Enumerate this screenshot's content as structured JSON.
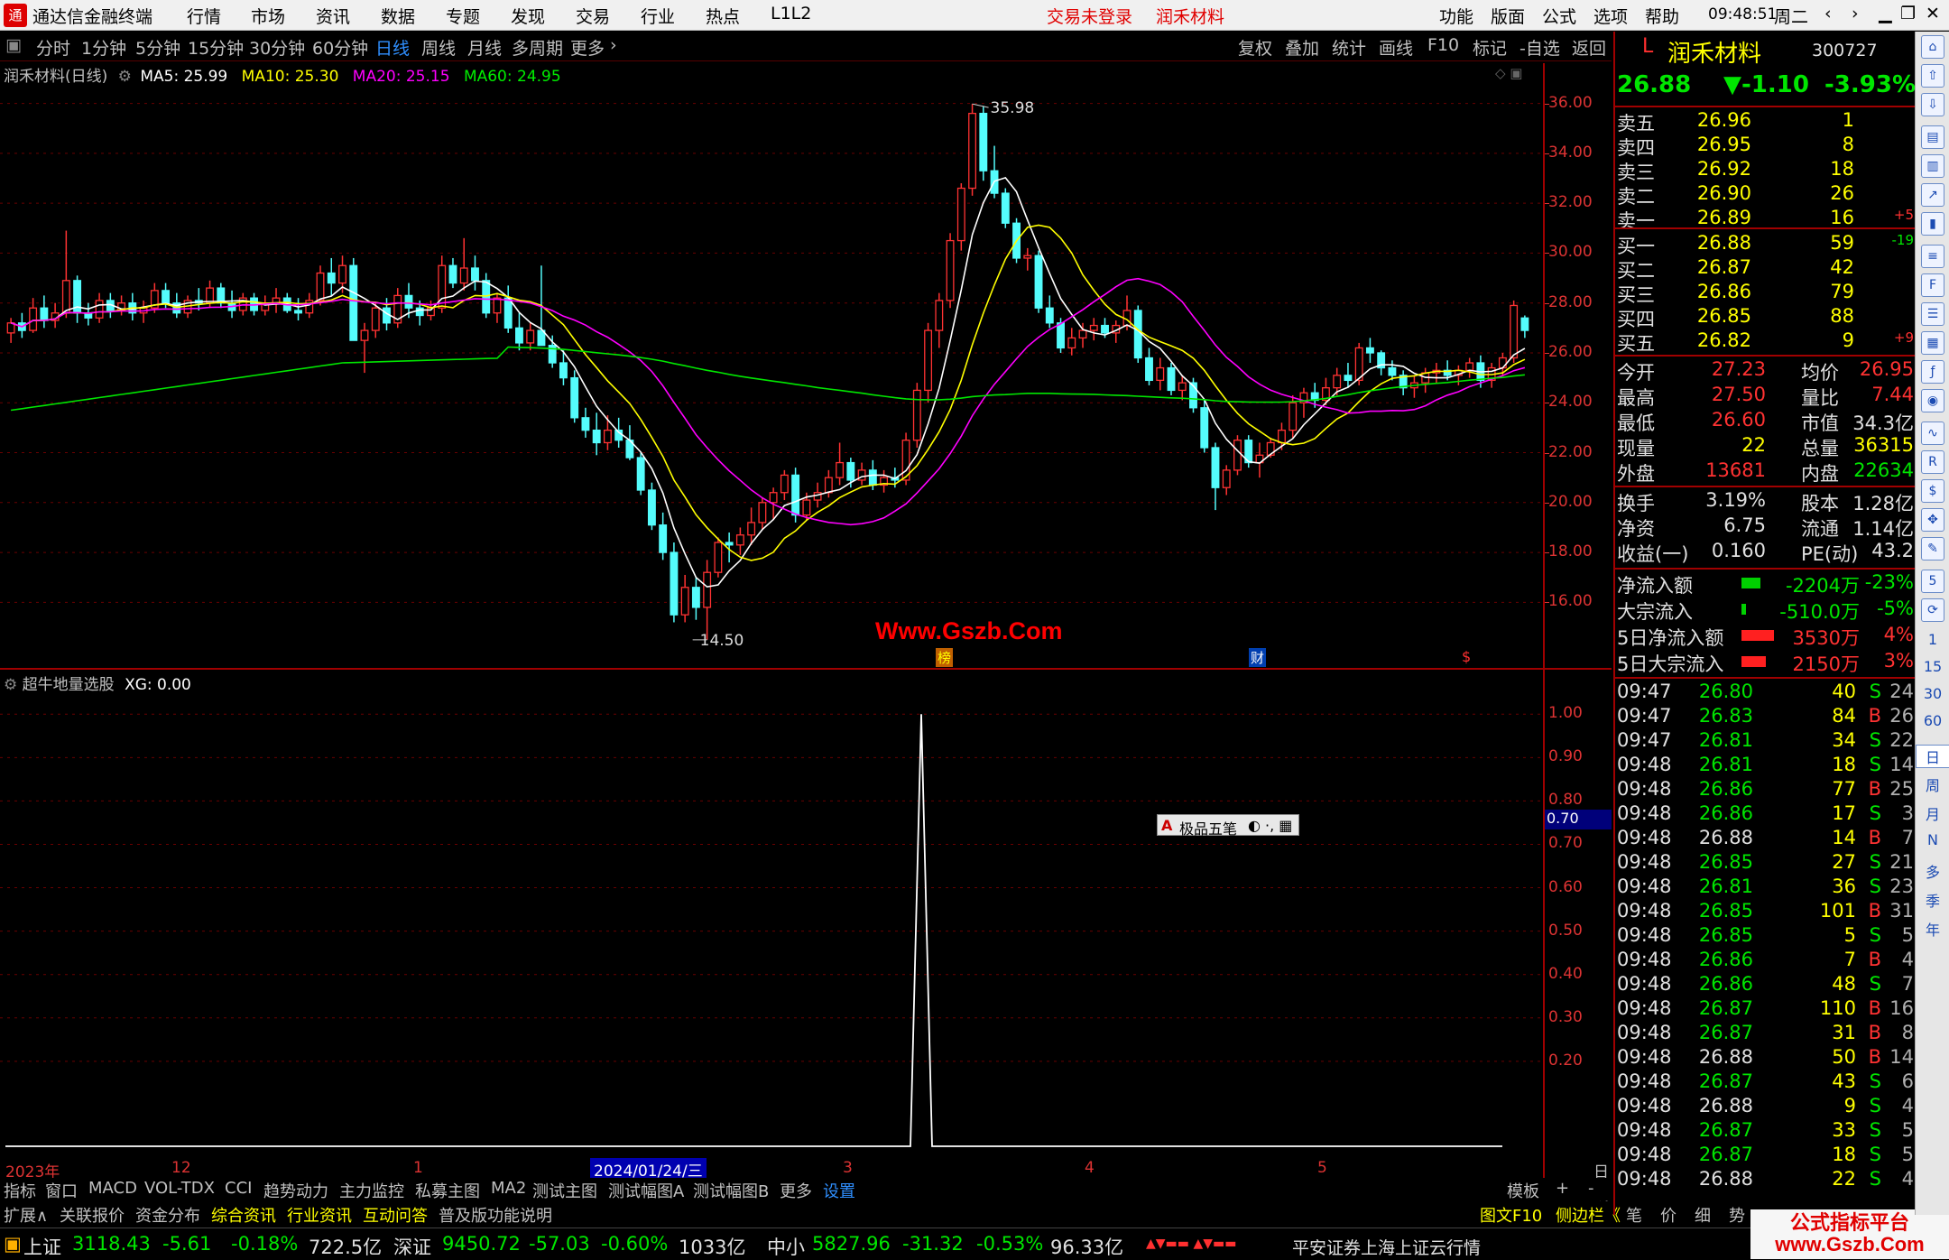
{
  "titlebar": {
    "app_title": "通达信金融终端",
    "menus": [
      "行情",
      "市场",
      "资讯",
      "数据",
      "专题",
      "发现",
      "交易",
      "行业",
      "热点",
      "L1L2"
    ],
    "login_status": "交易未登录",
    "stock_name": "润禾材料",
    "right_menus": [
      "功能",
      "版面",
      "公式",
      "选项",
      "帮助"
    ],
    "time": "09:48:51",
    "weekday": "周二"
  },
  "periods": {
    "items": [
      "分时",
      "1分钟",
      "5分钟",
      "15分钟",
      "30分钟",
      "60分钟",
      "日线",
      "周线",
      "月线",
      "多周期",
      "更多"
    ],
    "selected": "日线",
    "tools": [
      "复权",
      "叠加",
      "统计",
      "画线",
      "F10",
      "标记",
      "-自选",
      "返回"
    ]
  },
  "main_chart": {
    "title": "润禾材料(日线)",
    "ma_labels": [
      "MA5: 25.99",
      "MA10: 25.30",
      "MA20: 25.15",
      "MA60: 24.95"
    ],
    "high_label": "35.98",
    "low_label": "14.50",
    "y_ticks": [
      "36.00",
      "34.00",
      "32.00",
      "30.00",
      "28.00",
      "26.00",
      "24.00",
      "22.00",
      "20.00",
      "18.00",
      "16.00"
    ],
    "event_markers": [
      "榜",
      "财",
      "$"
    ]
  },
  "chart_data": {
    "type": "candlestick",
    "y_range": [
      15,
      36.6
    ],
    "high": 35.98,
    "low": 14.5,
    "ma_legend": {
      "MA5": 25.99,
      "MA10": 25.3,
      "MA20": 25.15,
      "MA60": 24.95
    },
    "colors": {
      "up": "#ff3232",
      "down": "#54fcfc",
      "ma5": "#ffffff",
      "ma10": "#ffff00",
      "ma20": "#ff00ff",
      "ma60": "#00e600"
    },
    "candles": [
      [
        26.8,
        27.4,
        26.4,
        27.2
      ],
      [
        27.2,
        27.6,
        26.6,
        26.9
      ],
      [
        26.9,
        28.2,
        26.8,
        27.8
      ],
      [
        27.8,
        28.3,
        27.0,
        27.3
      ],
      [
        27.3,
        28.0,
        27.0,
        27.6
      ],
      [
        27.6,
        30.9,
        27.4,
        28.9
      ],
      [
        28.9,
        29.1,
        27.2,
        27.6
      ],
      [
        27.6,
        28.0,
        27.1,
        27.4
      ],
      [
        27.4,
        28.4,
        27.2,
        28.1
      ],
      [
        28.1,
        28.4,
        27.4,
        27.7
      ],
      [
        27.7,
        28.3,
        27.5,
        28.0
      ],
      [
        28.0,
        28.4,
        27.3,
        27.6
      ],
      [
        27.6,
        28.1,
        27.2,
        27.8
      ],
      [
        27.8,
        28.8,
        27.6,
        28.5
      ],
      [
        28.5,
        28.8,
        27.8,
        28.0
      ],
      [
        28.0,
        28.4,
        27.4,
        27.6
      ],
      [
        27.6,
        28.3,
        27.4,
        28.1
      ],
      [
        28.1,
        28.6,
        27.7,
        28.0
      ],
      [
        28.0,
        28.9,
        27.8,
        28.6
      ],
      [
        28.6,
        28.8,
        27.8,
        28.0
      ],
      [
        28.0,
        28.5,
        27.4,
        27.7
      ],
      [
        27.7,
        28.4,
        27.5,
        28.2
      ],
      [
        28.2,
        28.4,
        27.5,
        27.7
      ],
      [
        27.7,
        28.3,
        27.5,
        28.0
      ],
      [
        28.0,
        28.6,
        27.6,
        28.2
      ],
      [
        28.2,
        28.4,
        27.6,
        27.7
      ],
      [
        27.7,
        28.2,
        27.3,
        27.6
      ],
      [
        27.6,
        28.4,
        27.4,
        28.1
      ],
      [
        28.1,
        29.5,
        27.9,
        29.2
      ],
      [
        29.2,
        29.8,
        28.3,
        28.8
      ],
      [
        28.8,
        29.9,
        28.4,
        29.5
      ],
      [
        29.5,
        29.8,
        27.6,
        26.5
      ],
      [
        26.5,
        27.2,
        25.2,
        26.9
      ],
      [
        26.9,
        28.0,
        26.6,
        27.8
      ],
      [
        27.8,
        28.2,
        26.9,
        27.2
      ],
      [
        27.2,
        28.6,
        27.0,
        28.3
      ],
      [
        28.3,
        28.8,
        27.4,
        27.8
      ],
      [
        27.8,
        28.1,
        27.1,
        27.5
      ],
      [
        27.5,
        28.1,
        27.3,
        27.8
      ],
      [
        27.8,
        29.9,
        27.6,
        29.5
      ],
      [
        29.5,
        29.8,
        28.6,
        28.8
      ],
      [
        28.8,
        30.6,
        28.5,
        29.4
      ],
      [
        29.4,
        29.9,
        28.5,
        28.9
      ],
      [
        28.9,
        29.2,
        27.4,
        27.6
      ],
      [
        27.6,
        28.4,
        27.2,
        28.2
      ],
      [
        28.2,
        28.7,
        26.8,
        27.0
      ],
      [
        27.0,
        27.6,
        26.1,
        26.4
      ],
      [
        26.4,
        27.2,
        26.1,
        26.9
      ],
      [
        26.9,
        29.5,
        26.6,
        26.3
      ],
      [
        26.3,
        26.7,
        25.4,
        25.6
      ],
      [
        25.6,
        26.1,
        24.7,
        25.0
      ],
      [
        25.0,
        25.3,
        23.2,
        23.4
      ],
      [
        23.4,
        23.8,
        22.6,
        22.9
      ],
      [
        22.9,
        23.6,
        21.9,
        22.4
      ],
      [
        22.4,
        23.5,
        22.1,
        22.9
      ],
      [
        22.9,
        23.4,
        22.2,
        22.5
      ],
      [
        22.5,
        23.1,
        21.7,
        21.8
      ],
      [
        21.8,
        22.0,
        20.3,
        20.5
      ],
      [
        20.5,
        20.8,
        18.9,
        19.1
      ],
      [
        19.1,
        19.6,
        17.7,
        18.0
      ],
      [
        18.0,
        18.4,
        15.2,
        15.5
      ],
      [
        15.5,
        17.1,
        15.2,
        16.6
      ],
      [
        16.6,
        17.0,
        15.3,
        15.8
      ],
      [
        15.8,
        17.7,
        14.5,
        17.2
      ],
      [
        17.2,
        18.6,
        17.0,
        18.4
      ],
      [
        18.4,
        18.8,
        17.6,
        18.3
      ],
      [
        18.3,
        19.0,
        17.9,
        18.7
      ],
      [
        18.7,
        19.8,
        18.3,
        19.2
      ],
      [
        19.2,
        20.2,
        18.9,
        20.0
      ],
      [
        20.0,
        20.6,
        19.3,
        20.4
      ],
      [
        20.4,
        21.3,
        20.1,
        21.1
      ],
      [
        21.1,
        21.4,
        19.2,
        19.5
      ],
      [
        19.5,
        20.4,
        19.3,
        20.1
      ],
      [
        20.1,
        20.8,
        19.8,
        20.4
      ],
      [
        20.4,
        21.3,
        20.2,
        21.0
      ],
      [
        21.0,
        22.4,
        20.7,
        21.6
      ],
      [
        21.6,
        21.8,
        20.6,
        20.9
      ],
      [
        20.9,
        21.6,
        20.7,
        21.3
      ],
      [
        21.3,
        21.7,
        20.5,
        20.7
      ],
      [
        20.7,
        21.3,
        20.4,
        21.0
      ],
      [
        21.0,
        21.4,
        20.6,
        20.9
      ],
      [
        20.9,
        22.8,
        20.7,
        22.5
      ],
      [
        22.5,
        24.8,
        22.2,
        24.5
      ],
      [
        24.5,
        27.2,
        24.0,
        26.9
      ],
      [
        26.9,
        28.4,
        26.2,
        28.1
      ],
      [
        28.1,
        30.8,
        27.8,
        30.5
      ],
      [
        30.5,
        32.8,
        30.1,
        32.6
      ],
      [
        32.6,
        35.98,
        32.3,
        35.6
      ],
      [
        35.6,
        35.9,
        32.9,
        33.3
      ],
      [
        33.3,
        34.3,
        32.2,
        32.4
      ],
      [
        32.4,
        32.6,
        31.0,
        31.2
      ],
      [
        31.2,
        31.4,
        29.6,
        29.8
      ],
      [
        29.8,
        30.2,
        29.3,
        29.9
      ],
      [
        29.9,
        30.1,
        27.6,
        27.8
      ],
      [
        27.8,
        28.3,
        27.0,
        27.2
      ],
      [
        27.2,
        27.4,
        26.0,
        26.2
      ],
      [
        26.2,
        27.0,
        25.9,
        26.6
      ],
      [
        26.6,
        27.2,
        26.2,
        26.9
      ],
      [
        26.9,
        27.4,
        26.5,
        27.1
      ],
      [
        27.1,
        27.4,
        26.6,
        26.8
      ],
      [
        26.8,
        27.3,
        26.4,
        27.1
      ],
      [
        27.1,
        28.3,
        26.9,
        27.7
      ],
      [
        27.7,
        27.9,
        25.6,
        25.8
      ],
      [
        25.8,
        26.2,
        24.7,
        24.9
      ],
      [
        24.9,
        25.8,
        24.5,
        25.4
      ],
      [
        25.4,
        25.6,
        24.3,
        24.5
      ],
      [
        24.5,
        25.1,
        24.1,
        24.8
      ],
      [
        24.8,
        25.0,
        23.6,
        23.8
      ],
      [
        23.8,
        24.1,
        22.0,
        22.2
      ],
      [
        22.2,
        22.4,
        19.7,
        20.6
      ],
      [
        20.6,
        21.5,
        20.3,
        21.3
      ],
      [
        21.3,
        22.7,
        21.1,
        22.5
      ],
      [
        22.5,
        22.7,
        21.4,
        21.6
      ],
      [
        21.6,
        22.4,
        21.0,
        21.9
      ],
      [
        21.9,
        22.6,
        21.8,
        22.4
      ],
      [
        22.4,
        23.2,
        22.1,
        22.9
      ],
      [
        22.9,
        24.3,
        22.6,
        24.0
      ],
      [
        24.0,
        24.6,
        23.4,
        24.4
      ],
      [
        24.4,
        24.8,
        23.8,
        24.1
      ],
      [
        24.1,
        25.0,
        23.9,
        24.6
      ],
      [
        24.6,
        25.4,
        24.3,
        25.1
      ],
      [
        25.1,
        25.6,
        24.6,
        24.9
      ],
      [
        24.9,
        26.4,
        24.7,
        26.2
      ],
      [
        26.2,
        26.6,
        25.6,
        26.0
      ],
      [
        26.0,
        26.1,
        25.1,
        25.4
      ],
      [
        25.4,
        25.7,
        24.9,
        25.1
      ],
      [
        25.1,
        25.3,
        24.3,
        24.6
      ],
      [
        24.6,
        25.1,
        24.2,
        24.8
      ],
      [
        24.8,
        25.4,
        24.4,
        25.2
      ],
      [
        25.2,
        25.6,
        24.8,
        25.3
      ],
      [
        25.3,
        25.7,
        24.9,
        25.1
      ],
      [
        25.1,
        25.5,
        24.7,
        25.3
      ],
      [
        25.3,
        25.8,
        25.0,
        25.6
      ],
      [
        25.6,
        25.9,
        24.6,
        24.9
      ],
      [
        24.9,
        25.6,
        24.6,
        25.4
      ],
      [
        25.4,
        26.0,
        25.1,
        25.8
      ],
      [
        25.8,
        28.1,
        25.6,
        27.9
      ],
      [
        27.4,
        27.5,
        26.6,
        26.9
      ]
    ]
  },
  "indicator": {
    "title": "超牛地量选股",
    "xg_value": "XG: 0.00",
    "y_ticks": [
      "1.00",
      "0.90",
      "0.80",
      "0.70",
      "0.60",
      "0.50",
      "0.40",
      "0.30",
      "0.20"
    ],
    "cursor_value": "0.70",
    "signal_value": 1.0
  },
  "ime": {
    "label": "极品五笔"
  },
  "time_axis": {
    "labels": [
      "2023年",
      "12",
      "1",
      "2024/01/24/三",
      "3",
      "4",
      "5"
    ],
    "period": "日线"
  },
  "quote": {
    "name": "润禾材料",
    "code": "300727",
    "price": "26.88",
    "change": "▼-1.10",
    "pct": "-3.93%",
    "asks": [
      {
        "label": "卖五",
        "price": "26.96",
        "vol": "1",
        "chg": ""
      },
      {
        "label": "卖四",
        "price": "26.95",
        "vol": "8",
        "chg": ""
      },
      {
        "label": "卖三",
        "price": "26.92",
        "vol": "18",
        "chg": ""
      },
      {
        "label": "卖二",
        "price": "26.90",
        "vol": "26",
        "chg": ""
      },
      {
        "label": "卖一",
        "price": "26.89",
        "vol": "16",
        "chg": "+5"
      }
    ],
    "bids": [
      {
        "label": "买一",
        "price": "26.88",
        "vol": "59",
        "chg": "-19"
      },
      {
        "label": "买二",
        "price": "26.87",
        "vol": "42",
        "chg": ""
      },
      {
        "label": "买三",
        "price": "26.86",
        "vol": "79",
        "chg": ""
      },
      {
        "label": "买四",
        "price": "26.85",
        "vol": "88",
        "chg": ""
      },
      {
        "label": "买五",
        "price": "26.82",
        "vol": "9",
        "chg": "+9"
      }
    ],
    "stats": [
      {
        "l1": "今开",
        "v1": "27.23",
        "l2": "均价",
        "v2": "26.95"
      },
      {
        "l1": "最高",
        "v1": "27.50",
        "l2": "量比",
        "v2": "7.44"
      },
      {
        "l1": "最低",
        "v1": "26.60",
        "l2": "市值",
        "v2": "34.3亿"
      },
      {
        "l1": "现量",
        "v1": "22",
        "l2": "总量",
        "v2": "36315"
      },
      {
        "l1": "外盘",
        "v1": "13681",
        "l2": "内盘",
        "v2": "22634"
      }
    ],
    "fund": [
      {
        "l1": "换手",
        "v1": "3.19%",
        "l2": "股本",
        "v2": "1.28亿"
      },
      {
        "l1": "净资",
        "v1": "6.75",
        "l2": "流通",
        "v2": "1.14亿"
      },
      {
        "l1": "收益(一)",
        "v1": "0.160",
        "l2": "PE(动)",
        "v2": "43.2"
      }
    ],
    "flows": [
      {
        "label": "净流入额",
        "value": "-2204万",
        "pct": "-23%",
        "bar": 0.23
      },
      {
        "label": "大宗流入",
        "value": "-510.0万",
        "pct": "-5%",
        "bar": 0.05
      },
      {
        "label": "5日净流入额",
        "value": "3530万",
        "pct": "4%",
        "bar": 0.4
      },
      {
        "label": "5日大宗流入",
        "value": "2150万",
        "pct": "3%",
        "bar": 0.3
      }
    ],
    "ticks": [
      [
        "09:47",
        "26.80",
        "40",
        "S",
        "24"
      ],
      [
        "09:47",
        "26.83",
        "84",
        "B",
        "26"
      ],
      [
        "09:47",
        "26.81",
        "34",
        "S",
        "22"
      ],
      [
        "09:48",
        "26.81",
        "18",
        "S",
        "14"
      ],
      [
        "09:48",
        "26.86",
        "77",
        "B",
        "25"
      ],
      [
        "09:48",
        "26.86",
        "17",
        "S",
        "3"
      ],
      [
        "09:48",
        "26.88",
        "14",
        "B",
        "7"
      ],
      [
        "09:48",
        "26.85",
        "27",
        "S",
        "21"
      ],
      [
        "09:48",
        "26.81",
        "36",
        "S",
        "23"
      ],
      [
        "09:48",
        "26.85",
        "101",
        "B",
        "31"
      ],
      [
        "09:48",
        "26.85",
        "5",
        "S",
        "5"
      ],
      [
        "09:48",
        "26.86",
        "7",
        "B",
        "4"
      ],
      [
        "09:48",
        "26.86",
        "48",
        "S",
        "7"
      ],
      [
        "09:48",
        "26.87",
        "110",
        "B",
        "16"
      ],
      [
        "09:48",
        "26.87",
        "31",
        "B",
        "8"
      ],
      [
        "09:48",
        "26.88",
        "50",
        "B",
        "14"
      ],
      [
        "09:48",
        "26.87",
        "43",
        "S",
        "6"
      ],
      [
        "09:48",
        "26.88",
        "9",
        "S",
        "4"
      ],
      [
        "09:48",
        "26.87",
        "33",
        "S",
        "5"
      ],
      [
        "09:48",
        "26.87",
        "18",
        "S",
        "5"
      ],
      [
        "09:48",
        "26.88",
        "22",
        "S",
        "4"
      ]
    ]
  },
  "sidebar": {
    "period_labels": [
      "1",
      "15",
      "30",
      "60",
      "日",
      "周",
      "月",
      "N",
      "多",
      "季",
      "年"
    ]
  },
  "bottom_tabs1": [
    "指标",
    "窗口",
    "MACD",
    "VOL-TDX",
    "CCI",
    "趋势动力",
    "主力监控",
    "私募主图",
    "MA2",
    "测试主图",
    "测试幅图A",
    "测试幅图B",
    "更多",
    "设置",
    "模板",
    "+",
    "-"
  ],
  "bottom_tabs2": {
    "items": [
      "扩展∧",
      "关联报价",
      "资金分布",
      "综合资讯",
      "行业资讯",
      "互动问答",
      "普及版功能说明"
    ],
    "right": [
      "图文F10",
      "侧边栏《",
      "笔",
      "价",
      "细",
      "势"
    ]
  },
  "status": {
    "sh_name": "上证",
    "sh_val": "3118.43",
    "sh_chg": "-5.61",
    "sh_pct": "-0.18%",
    "sh_amt": "722.5亿",
    "sz_name": "深证",
    "sz_val": "9450.72",
    "sz_chg": "-57.03",
    "sz_pct": "-0.60%",
    "sz_amt": "1033亿",
    "zx_name": "中小",
    "zx_val": "5827.96",
    "zx_chg": "-31.32",
    "zx_pct": "-0.53%",
    "zx_amt": "96.33亿",
    "server": "平安证券上海上证云行情"
  },
  "watermarks": {
    "center": "Www.Gszb.Com",
    "corner_line1": "公式指标平台",
    "corner_line2": "www.Gszb.Com"
  }
}
